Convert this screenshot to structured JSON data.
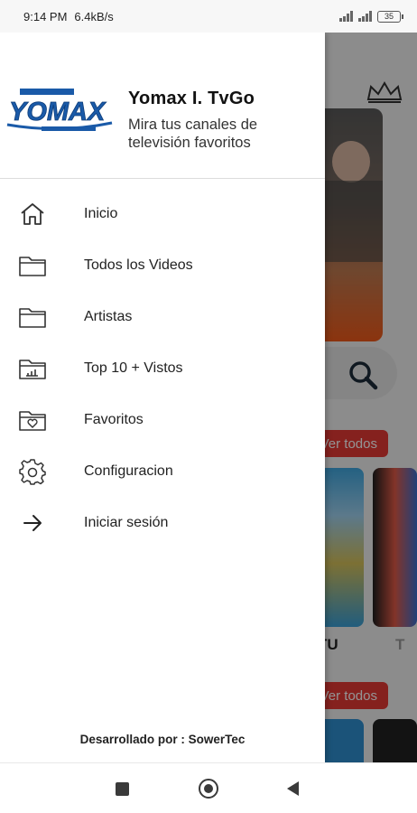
{
  "status_bar": {
    "time": "9:14 PM",
    "speed": "6.4kB/s",
    "battery": "35"
  },
  "drawer": {
    "logo_text": "YOMAX",
    "title": "Yomax I. TvGo",
    "subtitle": "Mira tus canales de televisión favoritos",
    "menu": [
      {
        "label": "Inicio",
        "icon": "home-icon"
      },
      {
        "label": "Todos los Videos",
        "icon": "folder-icon"
      },
      {
        "label": "Artistas",
        "icon": "folder-icon"
      },
      {
        "label": "Top 10 + Vistos",
        "icon": "folder-chart-icon"
      },
      {
        "label": "Favoritos",
        "icon": "folder-heart-icon"
      },
      {
        "label": "Configuracion",
        "icon": "gear-icon"
      },
      {
        "label": "Iniciar sesión",
        "icon": "arrow-right-icon"
      }
    ],
    "footer": "Desarrollado por : SowerTec"
  },
  "background": {
    "ver_todos_1": "Ver todos",
    "ver_todos_2": "Ver todos",
    "card_label_1": "TU",
    "card_label_2": "T"
  },
  "colors": {
    "accent_red": "#e53935",
    "logo_blue": "#1a5aa8"
  }
}
